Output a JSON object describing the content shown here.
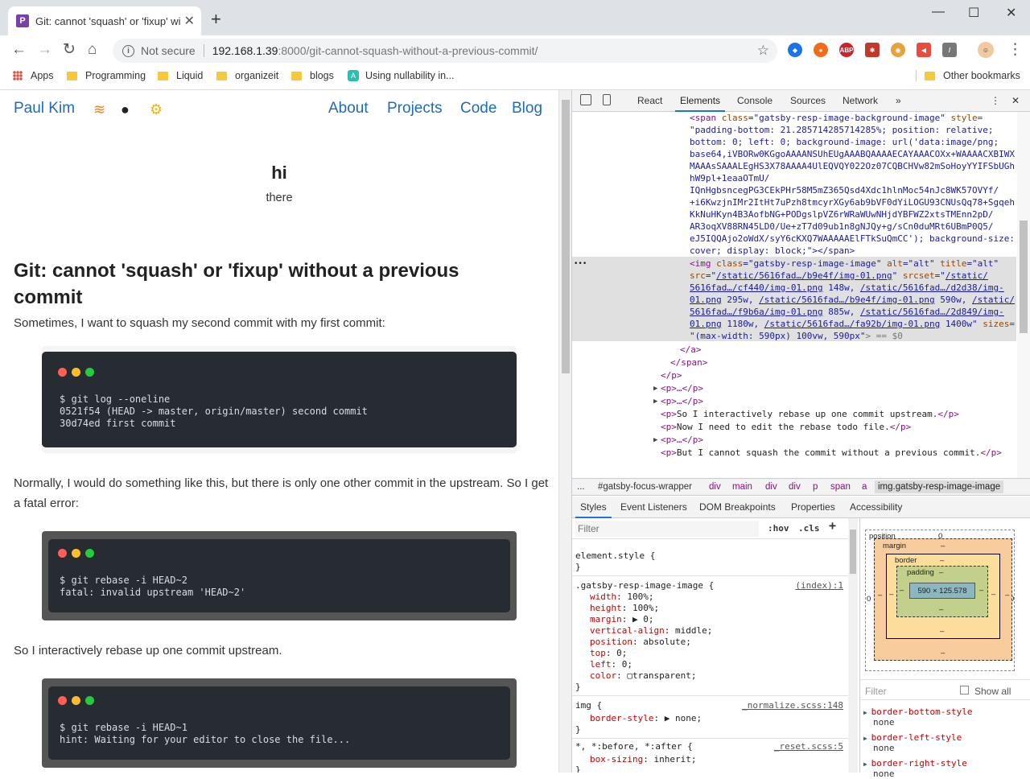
{
  "browser": {
    "tab_title": "Git: cannot 'squash' or 'fixup' without a previous commit",
    "tab_favicon": "P",
    "security": "Not secure",
    "url_host": "192.168.1.39",
    "url_rest": ":8000/git-cannot-squash-without-a-previous-commit/",
    "bookmarks": [
      {
        "label": "Apps",
        "icon": "apps-grid"
      },
      {
        "label": "Programming",
        "icon": "folder"
      },
      {
        "label": "Liquid",
        "icon": "folder"
      },
      {
        "label": "organizeit",
        "icon": "folder"
      },
      {
        "label": "blogs",
        "icon": "folder"
      },
      {
        "label": "Using nullability in...",
        "icon": "site"
      }
    ],
    "other_bookmarks": "Other bookmarks"
  },
  "site": {
    "brand": "Paul Kim",
    "nav": [
      "About",
      "Projects",
      "Code",
      "Blog"
    ],
    "hero_title": "hi",
    "hero_subtitle": "there",
    "post_title": "Git: cannot 'squash' or 'fixup' without a previous commit",
    "para1": "Sometimes, I want to squash my second commit with my first commit:",
    "term1": "$ git log --oneline\n0521f54 (HEAD -> master, origin/master) second commit\n30d74ed first commit",
    "para2": "Normally, I would do something like this, but there is only one other commit in the upstream. So I get a fatal error:",
    "term2": "$ git rebase -i HEAD~2\nfatal: invalid upstream 'HEAD~2'",
    "para3": "So I interactively rebase up one commit upstream.",
    "term3": "$ git rebase -i HEAD~1\nhint: Waiting for your editor to close the file..."
  },
  "devtools": {
    "tabs": [
      "React",
      "Elements",
      "Console",
      "Sources",
      "Network"
    ],
    "active_tab": "Elements",
    "more": "»",
    "breadcrumbs": [
      "...",
      "#gatsby-focus-wrapper",
      "div",
      "main",
      "div",
      "div",
      "p",
      "span",
      "a",
      "img.gatsby-resp-image-image"
    ],
    "subtabs": [
      "Styles",
      "Event Listeners",
      "DOM Breakpoints",
      "Properties",
      "Accessibility"
    ],
    "filter_placeholder": "Filter",
    "hov": ":hov",
    "cls": ".cls",
    "element_style": "element.style {",
    "rule1_selector": ".gatsby-resp-image-image {",
    "rule1_source": "(index):1",
    "rule1_props": [
      [
        "width",
        "100%;"
      ],
      [
        "height",
        "100%;"
      ],
      [
        "margin",
        "▶ 0;"
      ],
      [
        "vertical-align",
        "middle;"
      ],
      [
        "position",
        "absolute;"
      ],
      [
        "top",
        "0;"
      ],
      [
        "left",
        "0;"
      ],
      [
        "color",
        "▢transparent;"
      ]
    ],
    "rule2_selector": "img {",
    "rule2_source": "_normalize.scss:148",
    "rule2_prop": [
      "border-style",
      "▶ none;"
    ],
    "rule3_selector": "*, *:before, *:after {",
    "rule3_source": "_reset.scss:5",
    "rule3_prop": [
      "box-sizing",
      "inherit;"
    ],
    "boxmodel": {
      "position_label": "position",
      "position_value": "0",
      "margin_label": "margin",
      "border_label": "border",
      "padding_label": "padding",
      "dash": "–",
      "content": "590 × 125.578",
      "side_zero": "0"
    },
    "computed_filter": "Filter",
    "show_all": "Show all",
    "computed": [
      [
        "border-bottom-style",
        "none"
      ],
      [
        "border-left-style",
        "none"
      ],
      [
        "border-right-style",
        "none"
      ]
    ],
    "code_lines": {
      "l1a": "<span ",
      "l1b": "class",
      "l1c": "=\"gatsby-resp-image-background-image\" ",
      "l1d": "style",
      "l2": "\"padding-bottom: 21.285714285714285%; position: relative;",
      "l3": "bottom: 0; left: 0; background-image: url('data:image/png;",
      "l4": "base64,iVBORw0KGgoAAAANSUhEUgAAABQAAAAECAYAAACOXx+WAAAACXBIWX",
      "l5": "MAAAsSAAALEgHS3X78AAAA4UlEQVQY022Oz07CQBCHVw82mSoHoyYYIFSbUGh",
      "l6": "hW9pl+1eaaOTmU/",
      "l7": "IQnHgbsncegPG3CEkPHr58M5mZ365Qsd4Xdc1hlnMoc54nJc8WK57OVYf/",
      "l8": "+i6KwzjnIMr2ItHt7uPzh8tmcyrXGy6ab9bVF0dYiLOGU93CNUsQq78+Sgqeh",
      "l9": "KkNuHKyn4B3AofbNG+PODgslpVZ6rWRaWUwNHjdYBFWZ2xtsTMEnn2pD/",
      "l10": "AR3oqXV88RN45LD0/Ue+zT7d09ub1n8gNJQy+g/sCn0duMRt6UBmP0Q5/",
      "l11": "eJ5IQQAjo2oWdX/syY6cKXQ7WAAAAAElFTkSuQmCC'); background-size:",
      "l12": "cover; display: block;\"></span>",
      "img_a": "<img ",
      "img_b": "class",
      "img_c": "=\"gatsby-resp-image-image\" ",
      "img_d": "alt",
      "img_e": "=\"alt\" ",
      "img_f": "title",
      "img_g": "=\"alt\"",
      "src_a": "src",
      "src_b": "=\"",
      "src_link": "/static/5616fad…/b9e4f/img-01.png",
      "src_c": "\" ",
      "srcset_a": "srcset",
      "srcset_b": "=\"",
      "srcset_link1": "/static/",
      "ss2": "5616fad…/cf440/img-01.png",
      "ss2b": " 148w, ",
      "ss2c": "/static/5616fad…/d2d38/img-",
      "ss3": "01.png",
      "ss3b": " 295w, ",
      "ss3c": "/static/5616fad…/b9e4f/img-01.png",
      "ss3d": " 590w, ",
      "ss3e": "/static/",
      "ss4": "5616fad…/f9b6a/img-01.png",
      "ss4b": " 885w, ",
      "ss4c": "/static/5616fad…/2d849/img-",
      "ss5": "01.png",
      "ss5b": " 1180w, ",
      "ss5c": "/static/5616fad…/fa92b/img-01.png",
      "ss5d": " 1400w\" ",
      "ss5e": "sizes",
      "ss6": "\"(max-width: 590px) 100vw, 590px\"",
      "ss6b": "> == $0",
      "ca": "</a>",
      "cspan": "</span>",
      "cp": "</p>",
      "p1": "<p>…</p>",
      "p2": "<p>…</p>",
      "p3a": "<p>",
      "p3b": "So I interactively rebase up one commit upstream.",
      "p3c": "</p>",
      "p4a": "<p>",
      "p4b": "Now I need to edit the rebase todo file.",
      "p4c": "</p>",
      "p5": "<p>…</p>",
      "p6a": "<p>",
      "p6b": "But I cannot squash the commit without a previous commit.",
      "p6c": "</p>",
      "ellipsis": "•••"
    }
  }
}
